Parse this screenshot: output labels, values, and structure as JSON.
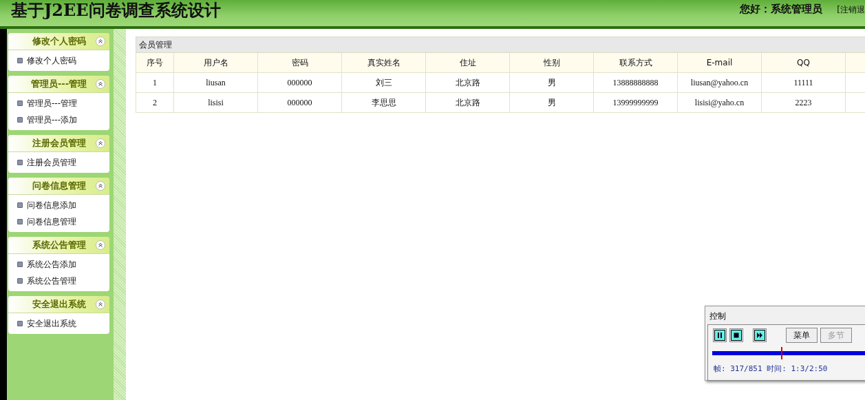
{
  "header": {
    "title": "基于J2EE问卷调查系统设计",
    "greeting": "您好：系统管理员",
    "logout": "[注销退"
  },
  "sidebar": {
    "groups": [
      {
        "title": "修改个人密码",
        "expanded": true,
        "items": [
          "修改个人密码"
        ]
      },
      {
        "title": "管理员---管理",
        "expanded": true,
        "items": [
          "管理员---管理",
          "管理员---添加"
        ]
      },
      {
        "title": "注册会员管理",
        "expanded": true,
        "items": [
          "注册会员管理"
        ]
      },
      {
        "title": "问卷信息管理",
        "expanded": true,
        "items": [
          "问卷信息添加",
          "问卷信息管理"
        ]
      },
      {
        "title": "系统公告管理",
        "expanded": true,
        "items": [
          "系统公告添加",
          "系统公告管理"
        ]
      },
      {
        "title": "安全退出系统",
        "expanded": true,
        "items": [
          "安全退出系统"
        ]
      }
    ]
  },
  "table": {
    "title": "会员管理",
    "columns": [
      "序号",
      "用户名",
      "密码",
      "真实姓名",
      "住址",
      "性别",
      "联系方式",
      "E-mail",
      "QQ"
    ],
    "rows": [
      [
        "1",
        "liusan",
        "000000",
        "刘三",
        "北京路",
        "男",
        "13888888888",
        "liusan@yahoo.cn",
        "11111"
      ],
      [
        "2",
        "lisisi",
        "000000",
        "李思思",
        "北京路",
        "男",
        "13999999999",
        "lisisi@yaho.cn",
        "2223"
      ]
    ]
  },
  "control_window": {
    "title": "控制",
    "buttons": [
      {
        "label": "菜单",
        "disabled": false
      },
      {
        "label": "多节",
        "disabled": true
      }
    ],
    "level": 0.37,
    "status": "帧: 317/851 时间: 1:3/2:50"
  }
}
